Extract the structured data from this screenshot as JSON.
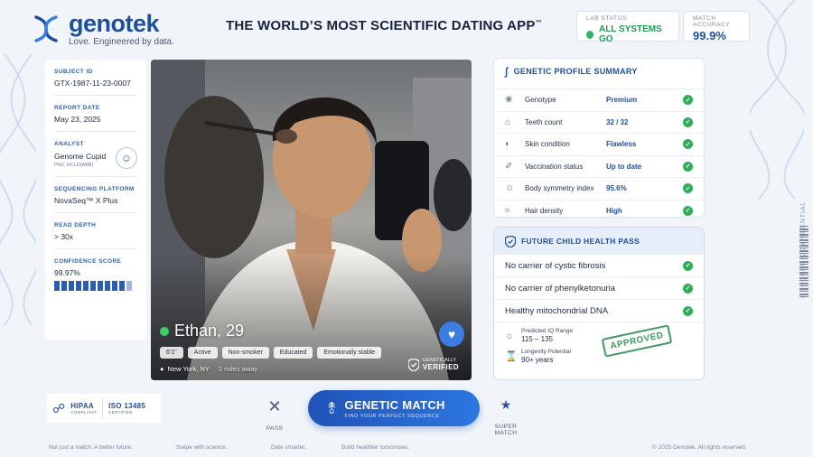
{
  "brand": {
    "name": "genotek",
    "tagline": "Love. Engineered by data."
  },
  "headline": "THE WORLD’S MOST SCIENTIFIC DATING APP",
  "headline_tm": "™",
  "lab_status": {
    "label": "LAB STATUS",
    "value": "ALL SYSTEMS GO"
  },
  "match_accuracy": {
    "label": "MATCH ACCURACY",
    "value": "99.9%"
  },
  "report": {
    "subject_id_label": "SUBJECT ID",
    "subject_id": "GTX-1987-11-23-0007",
    "report_date_label": "REPORT DATE",
    "report_date": "May 23, 2025",
    "analyst_label": "ANALYST",
    "analyst_name": "Genome Cupid",
    "analyst_credentials": "PhD, HCLD(ABB)",
    "platform_label": "SEQUENCING PLATFORM",
    "platform": "NovaSeq™ X Plus",
    "depth_label": "READ DEPTH",
    "depth": "> 30x",
    "confidence_label": "CONFIDENCE SCORE",
    "confidence": "99.97%",
    "confidence_level": 0.9
  },
  "profile_card": {
    "name_age": "Ethan, 29",
    "tags": [
      "6'1\"",
      "Active",
      "Non-smoker",
      "Educated",
      "Emotionally stable"
    ],
    "location": "New York, NY",
    "distance": "2 miles away",
    "verified_small": "GENETICALLY",
    "verified_big": "VERIFIED"
  },
  "genetic_summary": {
    "title": "GENETIC PROFILE SUMMARY",
    "rows": [
      {
        "icon": "genotype-icon",
        "label": "Genotype",
        "value": "Premium"
      },
      {
        "icon": "tooth-icon",
        "label": "Teeth count",
        "value": "32 / 32"
      },
      {
        "icon": "droplet-icon",
        "label": "Skin condition",
        "value": "Flawless"
      },
      {
        "icon": "syringe-icon",
        "label": "Vaccination status",
        "value": "Up to date"
      },
      {
        "icon": "body-icon",
        "label": "Body symmetry index",
        "value": "95.6%"
      },
      {
        "icon": "hair-icon",
        "label": "Hair density",
        "value": "High"
      }
    ]
  },
  "child_health": {
    "title": "FUTURE CHILD HEALTH PASS",
    "items": [
      "No carrier of cystic fibrosis",
      "No carrier of phenylketonuria",
      "Healthy mitochondrial DNA"
    ],
    "iq_label": "Predicted IQ Range",
    "iq_value": "115 – 135",
    "longevity_label": "Longevity Potential",
    "longevity_value": "90+ years",
    "stamp": "APPROVED"
  },
  "side_text": "GENOTEK CONFIDENTIAL",
  "badges": {
    "hipaa": "HIPAA",
    "hipaa_sub": "COMPLIANT",
    "iso": "ISO 13485",
    "iso_sub": "CERTIFIED"
  },
  "actions": {
    "pass_label": "PASS",
    "match_label": "GENETIC MATCH",
    "match_sub": "FIND YOUR PERFECT SEQUENCE",
    "super_label": "SUPER MATCH"
  },
  "footer": {
    "t1": "Not just a match. A better future.",
    "t2": "Swipe with science.",
    "t3": "Date smarter.",
    "t4": "Build healthier tomorrows.",
    "copyright": "© 2025 Genotek. All rights reserved."
  },
  "colors": {
    "brand_blue": "#1e4f9c",
    "accent_green": "#2fae5a",
    "background": "#f1f5fa"
  }
}
